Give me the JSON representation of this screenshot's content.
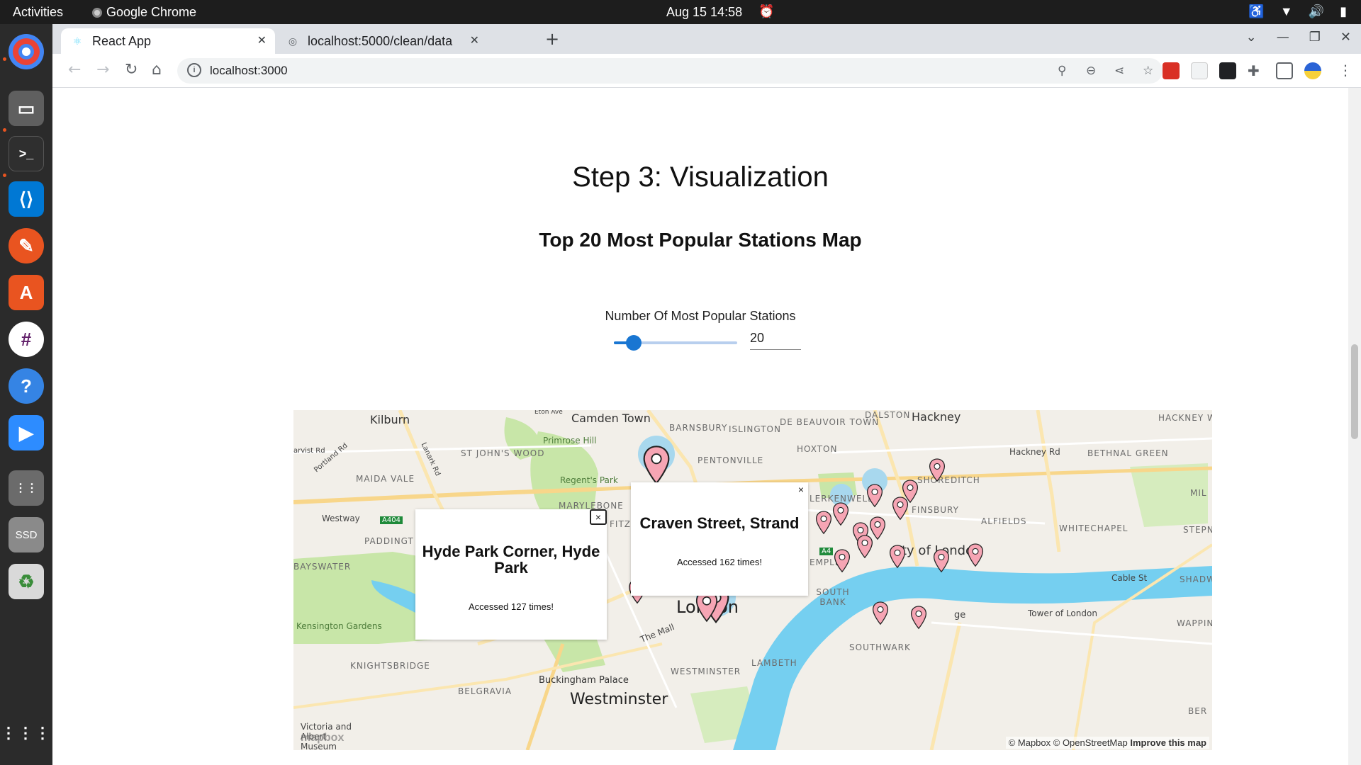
{
  "topbar": {
    "activities": "Activities",
    "app_name": "Google Chrome",
    "clock": "Aug 15  14:58"
  },
  "dock": {
    "items": [
      "Chrome",
      "Files",
      "Terminal",
      "Visual Studio Code",
      "Pencil",
      "Ubuntu Software",
      "Slack",
      "Help",
      "Zoom",
      "Disks",
      "SSD",
      "Trash",
      "Show Applications"
    ],
    "ssd_label": "SSD"
  },
  "browser": {
    "tabs": [
      {
        "title": "React App",
        "active": true
      },
      {
        "title": "localhost:5000/clean/data",
        "active": false
      }
    ],
    "url": "localhost:3000"
  },
  "page": {
    "step_title": "Step 3: Visualization",
    "map_title": "Top 20 Most Popular Stations Map",
    "slider_label": "Number Of Most Popular Stations",
    "slider_value": "20",
    "slider_fraction": 0.16
  },
  "map": {
    "labels": {
      "kilburn": "Kilburn",
      "camden_town": "Camden Town",
      "hackney": "Hackney",
      "dalston": "DALSTON",
      "hackney_wick": "HACKNEY WICK",
      "de_beauvoir": "DE BEAUVOIR TOWN",
      "barnsbury": "BARNSBURY",
      "islington": "ISLINGTON",
      "hoxton": "HOXTON",
      "bethnal_green": "BETHNAL GREEN",
      "hackney_rd": "Hackney Rd",
      "primrose_hill": "Primrose Hill",
      "st_johns_wood": "ST JOHN'S WOOD",
      "regents_park": "Regent's Park",
      "maida_vale": "MAIDA VALE",
      "pentonville": "PENTONVILLE",
      "shoreditch": "SHOREDITCH",
      "clerkenwell": "LERKENWELL",
      "finsbury": "FINSBURY",
      "spitalfields": "ALFIELDS",
      "whitechapel": "WHITECHAPEL",
      "stepney": "STEPN",
      "westway": "Westway",
      "a404": "A404",
      "paddington": "PADDINGT",
      "marylebone": "MARYLEBONE",
      "fitz": "FITZ",
      "bayswater": "BAYSWATER",
      "temple": "EMPLE",
      "city_of_london": "ty of London",
      "a4": "A4",
      "cable_st": "Cable St",
      "shadwell": "SHADW",
      "kensington_gardens": "Kensington Gardens",
      "london": "London",
      "south_bank": "SOUTH BANK",
      "the_mall": "The Mall",
      "london_bridge": "ge",
      "tower_of_london": "Tower of London",
      "wapping": "WAPPIN",
      "knightsbridge": "KNIGHTSBRIDGE",
      "westminster_district": "WESTMINSTER",
      "lambeth": "LAMBETH",
      "southwark": "SOUTHWARK",
      "buckingham_palace": "Buckingham Palace",
      "belgravia": "BELGRAVIA",
      "westminster": "Westminster",
      "victoria_albert": "Victoria and Albert Museum",
      "bermondsey": "BER",
      "portland_rd": "Portland Rd",
      "lanark_rd": "Lanark Rd",
      "harvist_rd": "arvist Rd",
      "eton_ave": "Eton Ave",
      "mile_end": "MIL"
    },
    "popups": [
      {
        "title": "Hyde Park Corner, Hyde Park",
        "text": "Accessed 127 times!"
      },
      {
        "title": "Craven Street, Strand",
        "text": "Accessed 162 times!"
      }
    ],
    "popup_close": "×",
    "attribution": "© Mapbox © OpenStreetMap",
    "improve": "Improve this map",
    "logo": "mapbox",
    "colors": {
      "water": "#75cff0",
      "park": "#c8e6a8",
      "marker_fill": "#f6a5b4",
      "marker_halo": "#a8d8ee",
      "accent": "#1976d2"
    }
  }
}
